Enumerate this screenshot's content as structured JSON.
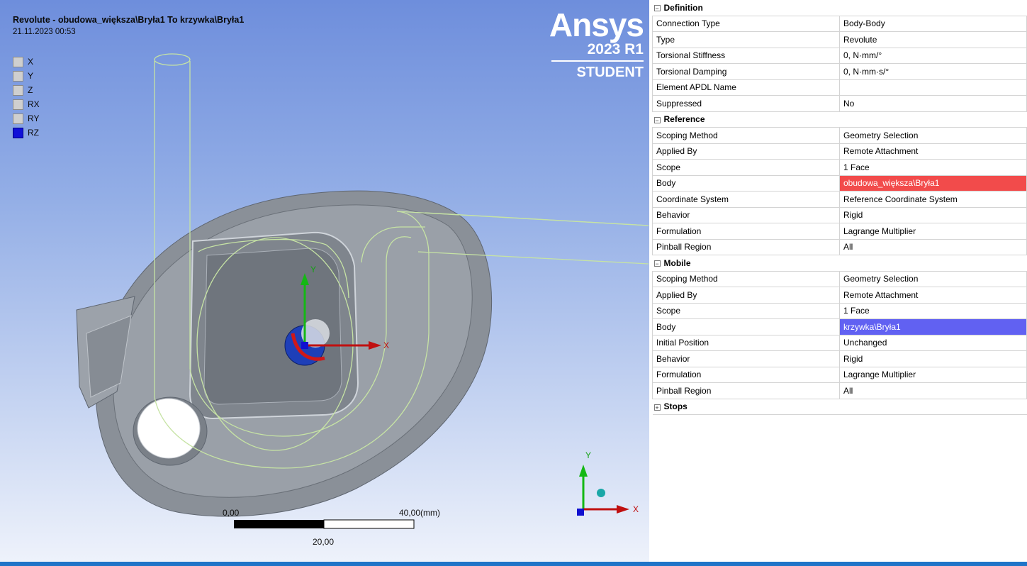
{
  "viewport": {
    "title": "Revolute - obudowa_większa\\Bryła1 To krzywka\\Bryła1",
    "date": "21.11.2023 00:53",
    "dofs": [
      {
        "label": "X",
        "on": false
      },
      {
        "label": "Y",
        "on": false
      },
      {
        "label": "Z",
        "on": false
      },
      {
        "label": "RX",
        "on": false
      },
      {
        "label": "RY",
        "on": false
      },
      {
        "label": "RZ",
        "on": true
      }
    ],
    "brand": {
      "name": "Ansys",
      "version": "2023 R1",
      "edition": "STUDENT"
    },
    "axes": {
      "x": "X",
      "y": "Y"
    },
    "scale": {
      "start": "0,00",
      "end": "40,00",
      "unit": "(mm)",
      "mid": "20,00"
    },
    "colors": {
      "reference_body": "#f24b4b",
      "mobile_body": "#6161f2",
      "csys_x": "#c01010",
      "csys_y": "#10a010",
      "csys_z": "#1010d0"
    }
  },
  "details": {
    "groups": [
      {
        "name": "Definition",
        "expanded": true,
        "rows": [
          {
            "key": "Connection Type",
            "value": "Body-Body"
          },
          {
            "key": "Type",
            "value": "Revolute"
          },
          {
            "key": "Torsional Stiffness",
            "value": "0, N·mm/°"
          },
          {
            "key": "Torsional Damping",
            "value": "0, N·mm·s/°"
          },
          {
            "key": "Element APDL Name",
            "value": ""
          },
          {
            "key": "Suppressed",
            "value": "No"
          }
        ]
      },
      {
        "name": "Reference",
        "expanded": true,
        "rows": [
          {
            "key": "Scoping Method",
            "value": "Geometry Selection"
          },
          {
            "key": "Applied By",
            "value": "Remote Attachment"
          },
          {
            "key": "Scope",
            "value": "1 Face"
          },
          {
            "key": "Body",
            "value": "obudowa_większa\\Bryła1",
            "highlight": "red"
          },
          {
            "key": "Coordinate System",
            "value": "Reference Coordinate System"
          },
          {
            "key": "Behavior",
            "value": "Rigid"
          },
          {
            "key": "Formulation",
            "value": "Lagrange Multiplier"
          },
          {
            "key": "Pinball Region",
            "value": "All"
          }
        ]
      },
      {
        "name": "Mobile",
        "expanded": true,
        "rows": [
          {
            "key": "Scoping Method",
            "value": "Geometry Selection"
          },
          {
            "key": "Applied By",
            "value": "Remote Attachment"
          },
          {
            "key": "Scope",
            "value": "1 Face"
          },
          {
            "key": "Body",
            "value": "krzywka\\Bryła1",
            "highlight": "blue"
          },
          {
            "key": "Initial Position",
            "value": "Unchanged"
          },
          {
            "key": "Behavior",
            "value": "Rigid"
          },
          {
            "key": "Formulation",
            "value": "Lagrange Multiplier"
          },
          {
            "key": "Pinball Region",
            "value": "All"
          }
        ]
      },
      {
        "name": "Stops",
        "expanded": false,
        "rows": []
      }
    ]
  }
}
